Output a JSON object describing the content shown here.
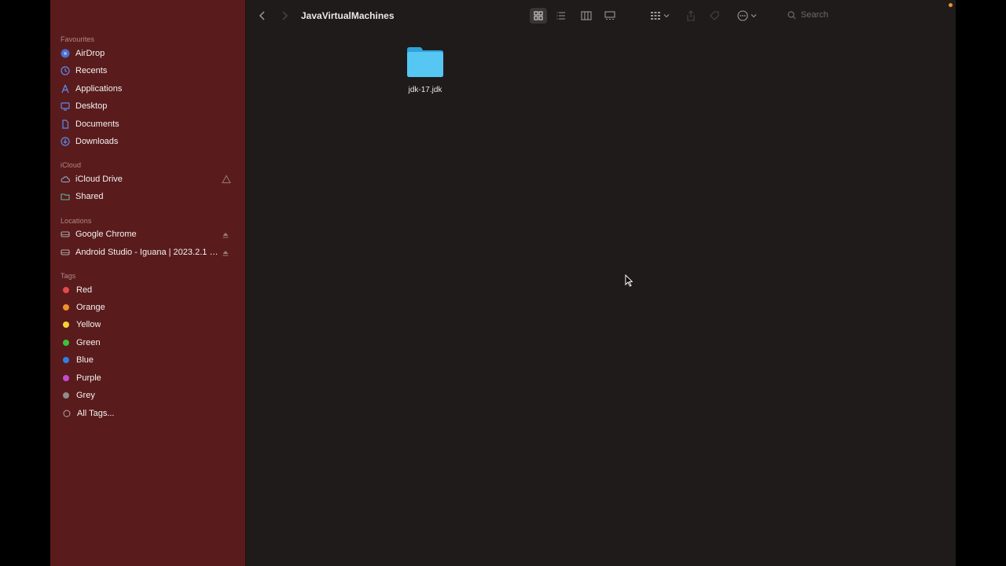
{
  "window": {
    "title": "JavaVirtualMachines"
  },
  "sidebar": {
    "favourites_title": "Favourites",
    "favourites": [
      {
        "label": "AirDrop",
        "icon": "airdrop-icon"
      },
      {
        "label": "Recents",
        "icon": "clock-icon"
      },
      {
        "label": "Applications",
        "icon": "applications-icon"
      },
      {
        "label": "Desktop",
        "icon": "desktop-icon"
      },
      {
        "label": "Documents",
        "icon": "document-icon"
      },
      {
        "label": "Downloads",
        "icon": "download-icon"
      }
    ],
    "icloud_title": "iCloud",
    "icloud": [
      {
        "label": "iCloud Drive",
        "icon": "cloud-icon"
      },
      {
        "label": "Shared",
        "icon": "shared-folder-icon"
      }
    ],
    "locations_title": "Locations",
    "locations": [
      {
        "label": "Google Chrome",
        "icon": "drive-icon"
      },
      {
        "label": "Android Studio - Iguana | 2023.2.1 P...",
        "icon": "drive-icon"
      }
    ],
    "tags_title": "Tags",
    "tags": [
      {
        "label": "Red",
        "color": "#e5484d"
      },
      {
        "label": "Orange",
        "color": "#f0912d"
      },
      {
        "label": "Yellow",
        "color": "#f5d330"
      },
      {
        "label": "Green",
        "color": "#3dc23d"
      },
      {
        "label": "Blue",
        "color": "#2f7ee8"
      },
      {
        "label": "Purple",
        "color": "#c34ad1"
      },
      {
        "label": "Grey",
        "color": "#8e8e8e"
      },
      {
        "label": "All Tags...",
        "icon": "all-tags-icon"
      }
    ]
  },
  "toolbar": {
    "search_placeholder": "Search"
  },
  "files": [
    {
      "name": "jdk-17.jdk",
      "icon": "folder-icon"
    }
  ],
  "colors": {
    "sidebar": "#5a1b1c",
    "content": "#1f1b1a",
    "accent": "#3d8bd9",
    "folder": "#4fc3f0"
  }
}
